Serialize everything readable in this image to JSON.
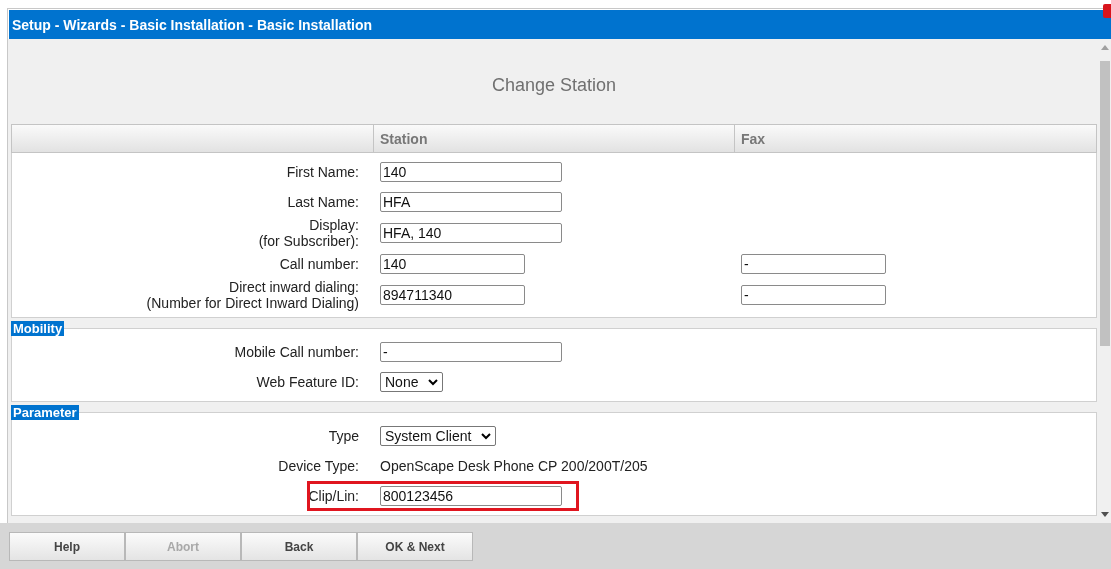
{
  "window": {
    "title": "Setup - Wizards - Basic Installation - Basic Installation"
  },
  "heading": "Change Station",
  "columns": [
    "Station",
    "Fax"
  ],
  "sections": [
    {
      "rows": [
        {
          "kind": "text",
          "label": "First Name:",
          "value": "140",
          "highlighted": false
        },
        {
          "kind": "text",
          "label": "Last Name:",
          "value": "HFA",
          "highlighted": false
        },
        {
          "kind": "text",
          "label": "Display:",
          "label2": "(for Subscriber):",
          "value": "HFA, 140",
          "highlighted": false
        },
        {
          "kind": "text",
          "label": "Call number:",
          "value": "140",
          "fax": "-",
          "highlighted": false
        },
        {
          "kind": "text",
          "label": "Direct inward dialing:",
          "label2": "(Number for Direct Inward Dialing)",
          "value": "894711340",
          "fax": "-",
          "highlighted": false
        }
      ]
    },
    {
      "title": "Mobility",
      "rows": [
        {
          "kind": "text",
          "label": "Mobile Call number:",
          "value": "-",
          "highlighted": false
        },
        {
          "kind": "select",
          "label": "Web Feature ID:",
          "value": "None",
          "highlighted": false
        }
      ]
    },
    {
      "title": "Parameter",
      "rows": [
        {
          "kind": "select",
          "label": "Type",
          "value": "System Client",
          "highlighted": false
        },
        {
          "kind": "static",
          "label": "Device Type:",
          "value": "OpenScape Desk Phone CP 200/200T/205",
          "highlighted": false
        },
        {
          "kind": "text",
          "label": "Clip/Lin:",
          "value": "800123456",
          "highlighted": true
        }
      ]
    }
  ],
  "buttons": [
    {
      "label": "Help",
      "disabled": false
    },
    {
      "label": "Abort",
      "disabled": true
    },
    {
      "label": "Back",
      "disabled": false
    },
    {
      "label": "OK & Next",
      "disabled": false
    }
  ]
}
